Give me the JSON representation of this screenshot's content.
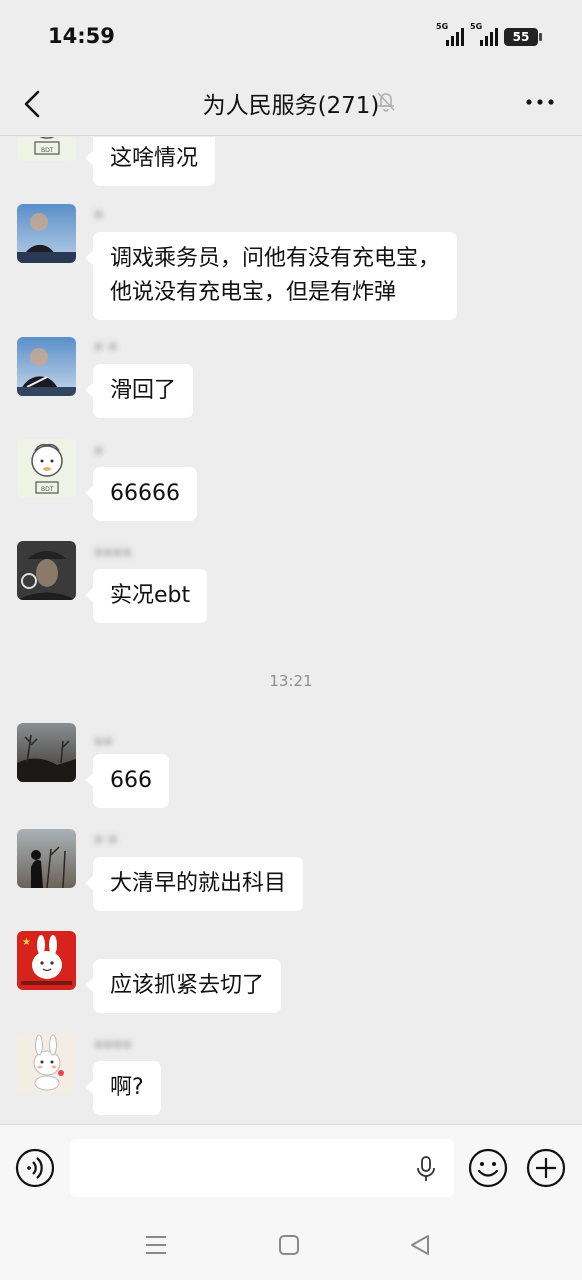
{
  "status_bar": {
    "time": "14:59",
    "signal1_label": "5G",
    "signal2_label": "5G",
    "battery": "55"
  },
  "header": {
    "title": "为人民服务(271)",
    "back_icon": "chevron-left-icon",
    "mute_icon": "bell-off-icon",
    "more_icon": "more-icon"
  },
  "messages": [
    {
      "avatar": "cartoon-boy",
      "sender": "",
      "text": "这啥情况"
    },
    {
      "avatar": "photo-person-blue",
      "sender": "▪",
      "text_lines": [
        "调戏乘务员，问他有没有充电宝，",
        "他说没有充电宝，但是有炸弹"
      ]
    },
    {
      "avatar": "photo-person-blue",
      "sender": "▪ ▪",
      "text": "滑回了"
    },
    {
      "avatar": "cartoon-boy",
      "sender": "▪",
      "text": "66666"
    },
    {
      "avatar": "photo-cowboy",
      "sender": "▪▪▪▪",
      "text": "实况ebt"
    },
    {
      "avatar": "photo-trees",
      "sender": "▪▪",
      "text": "666"
    },
    {
      "avatar": "photo-trees",
      "sender": "▪ ▪",
      "text": "大清早的就出科目"
    },
    {
      "avatar": "cartoon-rabbit-flag",
      "sender": "",
      "text": "应该抓紧去切了"
    },
    {
      "avatar": "cartoon-rabbit",
      "sender": "▪▪▪▪",
      "text": "啊?"
    }
  ],
  "time_separator": "13:21",
  "input_bar": {
    "placeholder": "",
    "voice_icon": "voice-icon",
    "mic_icon": "microphone-icon",
    "emoji_icon": "emoji-icon",
    "plus_icon": "plus-icon"
  },
  "system_nav": {
    "menu_icon": "menu-icon",
    "home_icon": "home-icon",
    "back_icon": "back-triangle-icon"
  },
  "colors": {
    "background": "#ededed",
    "bubble": "#ffffff",
    "text": "#111111",
    "timestamp": "#8f8f8f"
  }
}
